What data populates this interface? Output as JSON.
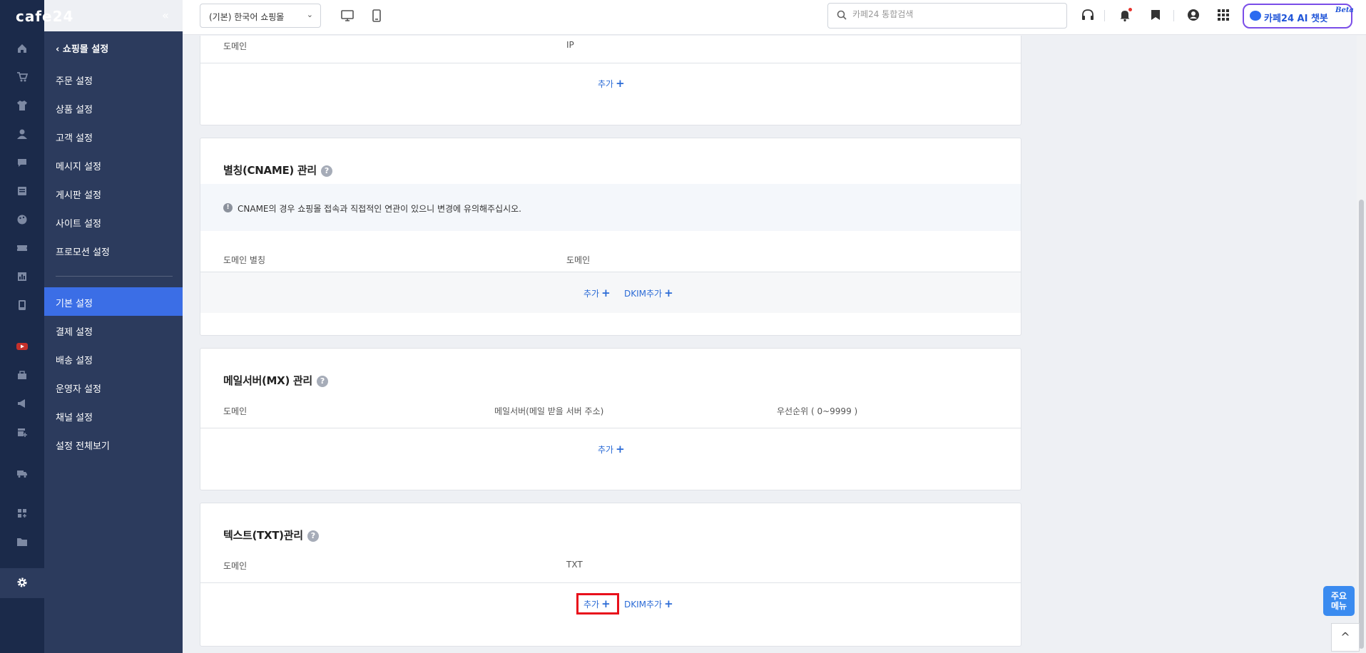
{
  "brand": {
    "logo_text": "cafe24"
  },
  "rail": {
    "icons": [
      "home-icon",
      "cart-icon",
      "shirt-icon",
      "user-icon",
      "chat-icon",
      "board-icon",
      "palette-icon",
      "coupon-icon",
      "stats-icon",
      "mobile-icon",
      "youtube-icon",
      "store-icon",
      "megaphone-icon",
      "shop-add-icon",
      "truck-icon",
      "apps-icon",
      "folder-icon",
      "settings-icon"
    ],
    "active": "settings-icon"
  },
  "submenu": {
    "collapse_label": "«",
    "back_label": "쇼핑몰 설정",
    "group1": [
      "주문 설정",
      "상품 설정",
      "고객 설정",
      "메시지 설정",
      "게시판 설정",
      "사이트 설정",
      "프로모션 설정"
    ],
    "group2": [
      "기본 설정",
      "결제 설정",
      "배송 설정",
      "운영자 설정",
      "채널 설정",
      "설정 전체보기"
    ],
    "active": "기본 설정"
  },
  "header": {
    "shop_select": "(기본) 한국어 쇼핑몰",
    "search_placeholder": "카페24 통합검색",
    "ai_label": "카페24 AI 챗봇",
    "ai_beta": "Beta"
  },
  "sections": {
    "top": {
      "columns": [
        "도메인",
        "IP"
      ],
      "add_label": "추가"
    },
    "cname": {
      "title": "별칭(CNAME) 관리",
      "notice": "CNAME의 경우 쇼핑몰 접속과 직접적인 연관이 있으니 변경에 유의해주십시오.",
      "columns": [
        "도메인 별칭",
        "도메인"
      ],
      "add_label": "추가",
      "dkim_label": "DKIM추가"
    },
    "mx": {
      "title": "메일서버(MX) 관리",
      "columns": [
        "도메인",
        "메일서버(메일 받을 서버 주소)",
        "우선순위 ( 0~9999 )"
      ],
      "add_label": "추가"
    },
    "txt": {
      "title": "텍스트(TXT)관리",
      "columns": [
        "도메인",
        "TXT"
      ],
      "add_label": "추가",
      "dkim_label": "DKIM추가"
    }
  },
  "floating": {
    "main_menu_line1": "주요",
    "main_menu_line2": "메뉴",
    "top_label": "^"
  },
  "colors": {
    "rail_bg": "#1b2a4a",
    "submenu_bg": "#2c3b5d",
    "active_item": "#3b6ee6",
    "link": "#2b6bd6",
    "highlight": "#e8101b",
    "ai_border": "#7a4de8"
  }
}
